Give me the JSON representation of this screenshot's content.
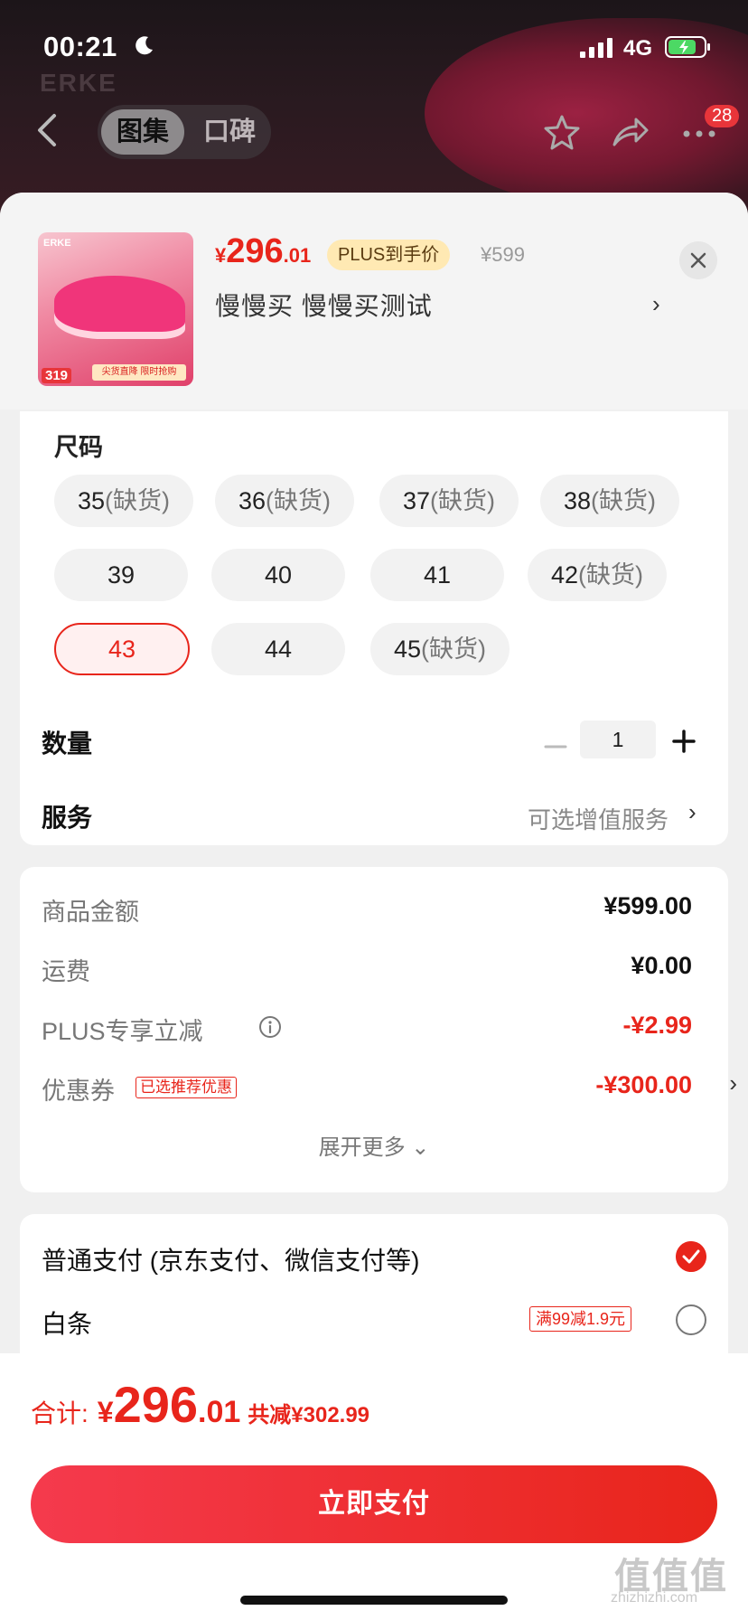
{
  "status_bar": {
    "time": "00:21",
    "network": "4G"
  },
  "background": {
    "brand": "ERKE",
    "tabs": [
      {
        "label": "图集"
      },
      {
        "label": "口碑"
      }
    ],
    "cart_badge": "28"
  },
  "product": {
    "currency": "¥",
    "price_int": "296",
    "price_dec": ".01",
    "plus_tag": "PLUS到手价",
    "original_price": "¥599",
    "variant": "慢慢买  慢慢买测试",
    "thumb": {
      "brand": "ERKE",
      "price": "319",
      "banner": "尖货直降 限时抢购"
    }
  },
  "size_section": {
    "title": "尺码",
    "out_of_stock_suffix": "(缺货)",
    "options": [
      {
        "size": "35",
        "oos": "(缺货)"
      },
      {
        "size": "36",
        "oos": "(缺货)"
      },
      {
        "size": "37",
        "oos": "(缺货)"
      },
      {
        "size": "38",
        "oos": "(缺货)"
      },
      {
        "size": "39",
        "oos": ""
      },
      {
        "size": "40",
        "oos": ""
      },
      {
        "size": "41",
        "oos": ""
      },
      {
        "size": "42",
        "oos": "(缺货)"
      },
      {
        "size": "43",
        "oos": ""
      },
      {
        "size": "44",
        "oos": ""
      },
      {
        "size": "45",
        "oos": "(缺货)"
      }
    ],
    "selected": "43"
  },
  "quantity": {
    "label": "数量",
    "value": "1"
  },
  "service": {
    "label": "服务",
    "value": "可选增值服务"
  },
  "amounts": {
    "rows": [
      {
        "label": "商品金额",
        "value": "¥599.00"
      },
      {
        "label": "运费",
        "value": "¥0.00"
      },
      {
        "label": "PLUS专享立减",
        "value": "-¥2.99"
      },
      {
        "label": "优惠券",
        "tag": "已选推荐优惠",
        "value": "-¥300.00"
      }
    ],
    "expand_label": "展开更多"
  },
  "payment": {
    "options": [
      {
        "label": "普通支付 (京东支付、微信支付等)",
        "selected": true
      },
      {
        "label": "白条",
        "promo": "满99减1.9元",
        "selected": false
      }
    ]
  },
  "footer": {
    "total_label": "合计:",
    "total_currency": "¥",
    "total_int": "296",
    "total_dec": ".01",
    "total_save": "共减¥302.99",
    "pay_button": "立即支付",
    "watermark": "值值值",
    "watermark_sub": "zhizhizhi.com"
  },
  "colors": {
    "accent": "#e8251b",
    "plus_tag_bg": "#ffe9b3"
  }
}
